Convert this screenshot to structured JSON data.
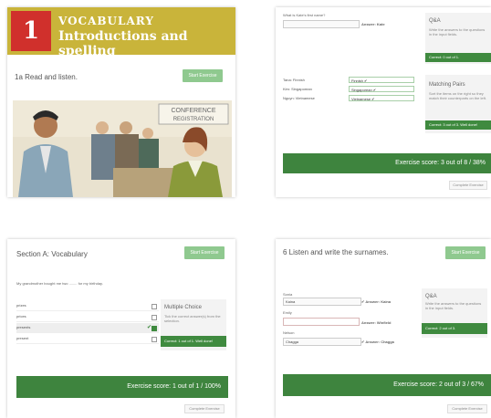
{
  "panel1": {
    "number": "1",
    "heading": "VOCABULARY",
    "subheading": "Introductions and spelling",
    "task": "1a Read and listen.",
    "start_button": "Start Exercise",
    "sign_line1": "CONFERENCE",
    "sign_line2": "REGISTRATION"
  },
  "panel2": {
    "question": "What is Kate's first name?",
    "answer_note": "Answer: Kate",
    "qa_title": "Q&A",
    "qa_desc": "Write the answers to the questions in the input fields.",
    "qa_status": "Correct: 0 out of 1.",
    "pairs": [
      {
        "label": "Tana: Finnish",
        "value": "Finnish ✔"
      },
      {
        "label": "Kim: Singaporean",
        "value": "Singaporean ✔"
      },
      {
        "label": "Nguyn: Vietnamese",
        "value": "Vietnamese ✔"
      }
    ],
    "match_title": "Matching Pairs",
    "match_desc": "Sort the items on the right so they match their counterparts on the left.",
    "match_status": "Correct: 3 out of 3. Well done!",
    "score": "Exercise score: 3 out of 8 / 38%",
    "complete_button": "Complete Exercise"
  },
  "panel3": {
    "title": "Section A: Vocabulary",
    "start_button": "Start Exercise",
    "sentence": "My grandmother bought me two ........ for my birthday.",
    "options": [
      {
        "text": "prizes",
        "checked": false
      },
      {
        "text": "prices",
        "checked": false
      },
      {
        "text": "presents",
        "checked": true
      },
      {
        "text": "present",
        "checked": false
      }
    ],
    "mc_title": "Multiple Choice",
    "mc_desc": "Tick the correct answer(s) from the selection.",
    "mc_status": "Correct: 1 out of 1. Well done!",
    "score": "Exercise score: 1 out of 1 / 100%",
    "complete_button": "Complete Exercise"
  },
  "panel4": {
    "title": "6 Listen and write the surnames.",
    "start_button": "Start Exercise",
    "fields": [
      {
        "label": "Sonia",
        "value": "Kaina",
        "answer": "✔ Answer: Kaina",
        "state": "correct"
      },
      {
        "label": "Emily",
        "value": "",
        "answer": "Answer: Winfield",
        "state": "wrong"
      },
      {
        "label": "Nelson",
        "value": "Chagga",
        "answer": "✔ Answer: Chagga",
        "state": "correct"
      }
    ],
    "qa_title": "Q&A",
    "qa_desc": "Write the answers to the questions in the input fields.",
    "qa_status": "Correct: 2 out of 3.",
    "score": "Exercise score: 2 out of 3 / 67%",
    "complete_button": "Complete Exercise"
  },
  "colors": {
    "header_gold": "#c9b43a",
    "header_red": "#d0302c",
    "green_dark": "#3f8a3f",
    "green_light": "#8fc98f"
  }
}
